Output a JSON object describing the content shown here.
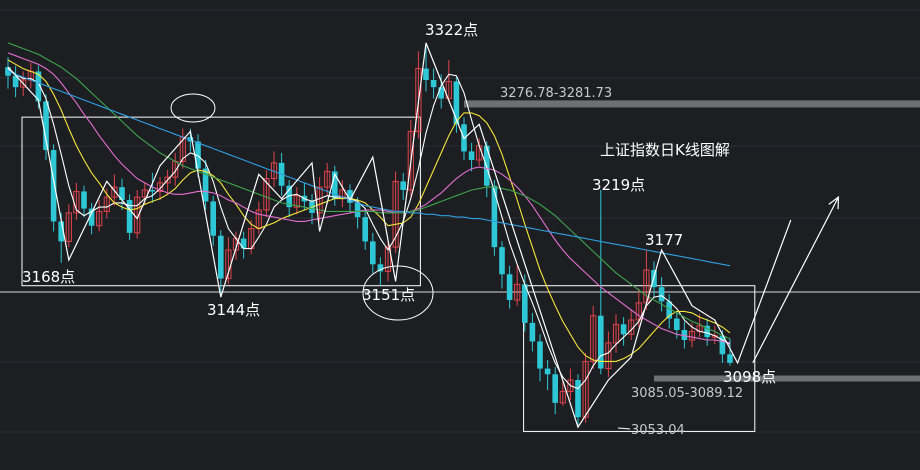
{
  "chart_data": {
    "type": "candlestick",
    "title": "上证指数日K线图解",
    "colors": {
      "background": "#1c1e22",
      "up": "#e0444a",
      "down": "#2ec7d6",
      "ma5": "#ffffff",
      "ma10": "#f5e63b",
      "ma20": "#e36fd1",
      "ma30": "#3fa44d",
      "ma60": "#2f9fe0",
      "resistance_band": "#8a8c90",
      "annotation": "#ffffff"
    },
    "y_range": [
      3030,
      3345
    ],
    "candles": [
      [
        3305,
        3299,
        3312,
        3290
      ],
      [
        3299,
        3291,
        3306,
        3284
      ],
      [
        3291,
        3296,
        3302,
        3285
      ],
      [
        3296,
        3302,
        3308,
        3290
      ],
      [
        3302,
        3281,
        3306,
        3276
      ],
      [
        3281,
        3247,
        3286,
        3240
      ],
      [
        3247,
        3197,
        3251,
        3190
      ],
      [
        3197,
        3183,
        3203,
        3168
      ],
      [
        3183,
        3203,
        3209,
        3179
      ],
      [
        3203,
        3218,
        3224,
        3198
      ],
      [
        3218,
        3206,
        3222,
        3200
      ],
      [
        3206,
        3194,
        3210,
        3188
      ],
      [
        3194,
        3204,
        3212,
        3190
      ],
      [
        3204,
        3214,
        3220,
        3199
      ],
      [
        3214,
        3221,
        3230,
        3208
      ],
      [
        3221,
        3212,
        3227,
        3205
      ],
      [
        3212,
        3189,
        3216,
        3184
      ],
      [
        3189,
        3214,
        3219,
        3185
      ],
      [
        3214,
        3219,
        3224,
        3209
      ],
      [
        3219,
        3218,
        3231,
        3210
      ],
      [
        3218,
        3224,
        3228,
        3212
      ],
      [
        3224,
        3228,
        3233,
        3216
      ],
      [
        3228,
        3239,
        3245,
        3222
      ],
      [
        3239,
        3256,
        3262,
        3234
      ],
      [
        3256,
        3253,
        3262,
        3246
      ],
      [
        3253,
        3234,
        3258,
        3228
      ],
      [
        3234,
        3211,
        3240,
        3205
      ],
      [
        3211,
        3187,
        3215,
        3180
      ],
      [
        3187,
        3157,
        3191,
        3144
      ],
      [
        3157,
        3177,
        3186,
        3153
      ],
      [
        3177,
        3185,
        3190,
        3170
      ],
      [
        3185,
        3178,
        3190,
        3171
      ],
      [
        3178,
        3192,
        3198,
        3174
      ],
      [
        3192,
        3205,
        3211,
        3188
      ],
      [
        3205,
        3227,
        3233,
        3200
      ],
      [
        3227,
        3238,
        3246,
        3221
      ],
      [
        3238,
        3222,
        3245,
        3215
      ],
      [
        3222,
        3207,
        3226,
        3200
      ],
      [
        3207,
        3215,
        3221,
        3202
      ],
      [
        3215,
        3211,
        3224,
        3205
      ],
      [
        3211,
        3203,
        3216,
        3195
      ],
      [
        3203,
        3221,
        3228,
        3197
      ],
      [
        3221,
        3232,
        3238,
        3215
      ],
      [
        3232,
        3213,
        3236,
        3208
      ],
      [
        3213,
        3219,
        3226,
        3207
      ],
      [
        3219,
        3210,
        3223,
        3203
      ],
      [
        3210,
        3200,
        3214,
        3192
      ],
      [
        3200,
        3183,
        3205,
        3177
      ],
      [
        3183,
        3167,
        3189,
        3160
      ],
      [
        3167,
        3162,
        3172,
        3152
      ],
      [
        3162,
        3179,
        3185,
        3155
      ],
      [
        3179,
        3225,
        3232,
        3175
      ],
      [
        3225,
        3219,
        3231,
        3212
      ],
      [
        3219,
        3260,
        3268,
        3214
      ],
      [
        3260,
        3304,
        3316,
        3255
      ],
      [
        3304,
        3296,
        3322,
        3288
      ],
      [
        3296,
        3291,
        3304,
        3283
      ],
      [
        3291,
        3283,
        3300,
        3276
      ],
      [
        3283,
        3295,
        3310,
        3281
      ],
      [
        3295,
        3265,
        3298,
        3259
      ],
      [
        3265,
        3246,
        3270,
        3240
      ],
      [
        3246,
        3240,
        3252,
        3232
      ],
      [
        3240,
        3250,
        3255,
        3236
      ],
      [
        3250,
        3222,
        3253,
        3214
      ],
      [
        3222,
        3179,
        3226,
        3173
      ],
      [
        3179,
        3160,
        3183,
        3150
      ],
      [
        3160,
        3142,
        3166,
        3136
      ],
      [
        3142,
        3153,
        3166,
        3138
      ],
      [
        3153,
        3126,
        3160,
        3120
      ],
      [
        3126,
        3113,
        3133,
        3106
      ],
      [
        3113,
        3094,
        3118,
        3085
      ],
      [
        3094,
        3090,
        3100,
        3079
      ],
      [
        3090,
        3070,
        3095,
        3062
      ],
      [
        3070,
        3078,
        3085,
        3068
      ],
      [
        3078,
        3086,
        3094,
        3072
      ],
      [
        3086,
        3060,
        3090,
        3053
      ],
      [
        3060,
        3099,
        3105,
        3056
      ],
      [
        3099,
        3131,
        3138,
        3094
      ],
      [
        3131,
        3094,
        3219,
        3090
      ],
      [
        3094,
        3112,
        3120,
        3088
      ],
      [
        3112,
        3125,
        3132,
        3105
      ],
      [
        3125,
        3118,
        3130,
        3110
      ],
      [
        3118,
        3128,
        3135,
        3114
      ],
      [
        3128,
        3140,
        3150,
        3123
      ],
      [
        3140,
        3163,
        3177,
        3135
      ],
      [
        3163,
        3151,
        3169,
        3144
      ],
      [
        3151,
        3141,
        3158,
        3134
      ],
      [
        3141,
        3129,
        3146,
        3122
      ],
      [
        3129,
        3121,
        3134,
        3115
      ],
      [
        3121,
        3114,
        3127,
        3108
      ],
      [
        3114,
        3120,
        3126,
        3109
      ],
      [
        3120,
        3124,
        3132,
        3116
      ],
      [
        3124,
        3116,
        3129,
        3110
      ],
      [
        3116,
        3117,
        3124,
        3111
      ],
      [
        3117,
        3104,
        3121,
        3098
      ],
      [
        3104,
        3098,
        3115,
        3096
      ]
    ],
    "ma_lines": [
      {
        "key": "ma5",
        "values": [
          3304,
          3300,
          3297,
          3297,
          3294,
          3283,
          3265,
          3244,
          3222,
          3205,
          3201,
          3204,
          3207,
          3207,
          3210,
          3210,
          3208,
          3208,
          3213,
          3215,
          3220,
          3226,
          3232,
          3241,
          3245,
          3243,
          3238,
          3225,
          3207,
          3192,
          3185,
          3178,
          3178,
          3186,
          3195,
          3207,
          3212,
          3215,
          3216,
          3213,
          3211,
          3213,
          3215,
          3214,
          3214,
          3213,
          3211,
          3206,
          3195,
          3185,
          3177,
          3186,
          3197,
          3213,
          3234,
          3259,
          3278,
          3292,
          3300,
          3299,
          3287,
          3268,
          3250,
          3235,
          3218,
          3200,
          3182,
          3167,
          3153,
          3140,
          3126,
          3111,
          3098,
          3088,
          3082,
          3080,
          3086,
          3096,
          3103,
          3105,
          3111,
          3116,
          3121,
          3127,
          3138,
          3144,
          3145,
          3141,
          3136,
          3128,
          3123,
          3120,
          3119,
          3117,
          3114,
          3111
        ]
      },
      {
        "key": "ma10",
        "values": [
          3310,
          3307,
          3304,
          3302,
          3300,
          3295,
          3286,
          3275,
          3262,
          3250,
          3240,
          3231,
          3224,
          3216,
          3210,
          3207,
          3205,
          3206,
          3209,
          3211,
          3213,
          3216,
          3220,
          3226,
          3231,
          3233,
          3232,
          3229,
          3224,
          3216,
          3209,
          3201,
          3195,
          3192,
          3194,
          3196,
          3199,
          3201,
          3203,
          3205,
          3207,
          3209,
          3211,
          3213,
          3213,
          3213,
          3212,
          3210,
          3205,
          3200,
          3194,
          3195,
          3196,
          3200,
          3209,
          3221,
          3233,
          3245,
          3257,
          3267,
          3273,
          3273,
          3271,
          3266,
          3257,
          3244,
          3228,
          3212,
          3195,
          3179,
          3163,
          3150,
          3138,
          3127,
          3118,
          3109,
          3103,
          3100,
          3099,
          3099,
          3099,
          3101,
          3104,
          3108,
          3114,
          3120,
          3126,
          3131,
          3134,
          3134,
          3133,
          3130,
          3128,
          3126,
          3123,
          3119
        ]
      },
      {
        "key": "ma20",
        "values": [
          3315,
          3313,
          3311,
          3309,
          3307,
          3304,
          3300,
          3294,
          3287,
          3280,
          3272,
          3265,
          3257,
          3250,
          3243,
          3237,
          3232,
          3227,
          3224,
          3221,
          3219,
          3217,
          3216,
          3216,
          3217,
          3218,
          3218,
          3217,
          3215,
          3212,
          3210,
          3207,
          3204,
          3202,
          3201,
          3200,
          3199,
          3198,
          3197,
          3197,
          3198,
          3199,
          3200,
          3201,
          3202,
          3203,
          3204,
          3205,
          3205,
          3205,
          3204,
          3203,
          3203,
          3204,
          3206,
          3209,
          3213,
          3217,
          3222,
          3227,
          3231,
          3234,
          3235,
          3234,
          3233,
          3230,
          3226,
          3221,
          3215,
          3208,
          3200,
          3192,
          3184,
          3177,
          3171,
          3166,
          3161,
          3156,
          3151,
          3147,
          3143,
          3139,
          3135,
          3131,
          3128,
          3125,
          3122,
          3120,
          3118,
          3117,
          3116,
          3115,
          3114,
          3114,
          3113,
          3112
        ]
      },
      {
        "key": "ma30",
        "values": [
          3322,
          3320,
          3318,
          3316,
          3314,
          3311,
          3308,
          3305,
          3301,
          3297,
          3292,
          3287,
          3282,
          3277,
          3272,
          3267,
          3262,
          3257,
          3253,
          3249,
          3245,
          3242,
          3239,
          3236,
          3234,
          3232,
          3230,
          3228,
          3226,
          3224,
          3222,
          3220,
          3218,
          3216,
          3214,
          3212,
          3210,
          3209,
          3208,
          3207,
          3206,
          3205,
          3204,
          3204,
          3204,
          3204,
          3204,
          3204,
          3204,
          3203,
          3203,
          3203,
          3203,
          3204,
          3205,
          3207,
          3209,
          3211,
          3213,
          3215,
          3217,
          3219,
          3220,
          3221,
          3221,
          3220,
          3219,
          3217,
          3215,
          3212,
          3209,
          3205,
          3201,
          3196,
          3191,
          3186,
          3181,
          3176,
          3171,
          3166,
          3161,
          3157,
          3153,
          3149,
          3145,
          3142,
          3139,
          3136,
          3133,
          3130,
          3127,
          3125,
          3122,
          3120,
          3117,
          3115
        ]
      },
      {
        "key": "ma60",
        "values": [
          3302,
          3300,
          3298,
          3296,
          3294,
          3292,
          3290,
          3288,
          3286,
          3284,
          3282,
          3280,
          3278,
          3276,
          3274,
          3272,
          3270,
          3268,
          3266,
          3264,
          3262,
          3260,
          3258,
          3256,
          3254,
          3252,
          3250,
          3248,
          3246,
          3244,
          3242,
          3240,
          3238,
          3236,
          3234,
          3232,
          3230,
          3228,
          3226,
          3224,
          3222,
          3220,
          3218,
          3216,
          3214,
          3212,
          3210,
          3208,
          3207,
          3206,
          3205,
          3204,
          3204,
          3203,
          3203,
          3202,
          3202,
          3201,
          3201,
          3200,
          3200,
          3199,
          3199,
          3198,
          3197,
          3196,
          3195,
          3194,
          3193,
          3192,
          3191,
          3190,
          3189,
          3188,
          3187,
          3186,
          3185,
          3184,
          3183,
          3182,
          3181,
          3180,
          3179,
          3178,
          3177,
          3176,
          3175,
          3174,
          3173,
          3172,
          3171,
          3170,
          3169,
          3168,
          3167,
          3166
        ]
      }
    ],
    "zigzag": [
      [
        0,
        3305
      ],
      [
        4,
        3282
      ],
      [
        8,
        3170
      ],
      [
        13,
        3225
      ],
      [
        17,
        3199
      ],
      [
        20,
        3236
      ],
      [
        24,
        3260
      ],
      [
        28,
        3144
      ],
      [
        33,
        3230
      ],
      [
        36,
        3213
      ],
      [
        40,
        3238
      ],
      [
        41,
        3190
      ],
      [
        43,
        3230
      ],
      [
        45,
        3212
      ],
      [
        48,
        3242
      ],
      [
        51,
        3155
      ],
      [
        55,
        3322
      ],
      [
        60,
        3255
      ],
      [
        62,
        3265
      ],
      [
        75,
        3053
      ],
      [
        79,
        3086
      ],
      [
        82,
        3102
      ],
      [
        86,
        3177
      ],
      [
        90,
        3138
      ],
      [
        93,
        3128
      ],
      [
        96,
        3098
      ],
      [
        100,
        3155
      ],
      [
        103,
        3198
      ]
    ],
    "resistance_bands": [
      {
        "label": "3276.78-3281.73",
        "low": 3276.78,
        "high": 3281.73,
        "from": 60,
        "to": 104
      },
      {
        "label": "3085.05-3089.12",
        "low": 3085.05,
        "high": 3089.12,
        "from": 85,
        "to": 104
      }
    ],
    "levels": [
      {
        "name": "3168点",
        "value": 3168
      },
      {
        "name": "3144点",
        "value": 3144
      },
      {
        "name": "3151点",
        "value": 3151
      },
      {
        "name": "3322点",
        "value": 3322
      },
      {
        "name": "3219点",
        "value": 3219
      },
      {
        "name": "3177",
        "value": 3177
      },
      {
        "name": "3098点",
        "value": 3098
      },
      {
        "name": "3053.04",
        "value": 3053.04
      }
    ],
    "boxes": [
      {
        "label": "",
        "top": 3270,
        "bottom": 3152,
        "from": 0,
        "to": 54
      },
      {
        "label": "",
        "top": 3152,
        "bottom": 3050,
        "from": 66,
        "to": 98
      }
    ],
    "forecast_arrow": {
      "from": [
        98,
        3098
      ],
      "to": [
        104,
        3200
      ]
    }
  }
}
